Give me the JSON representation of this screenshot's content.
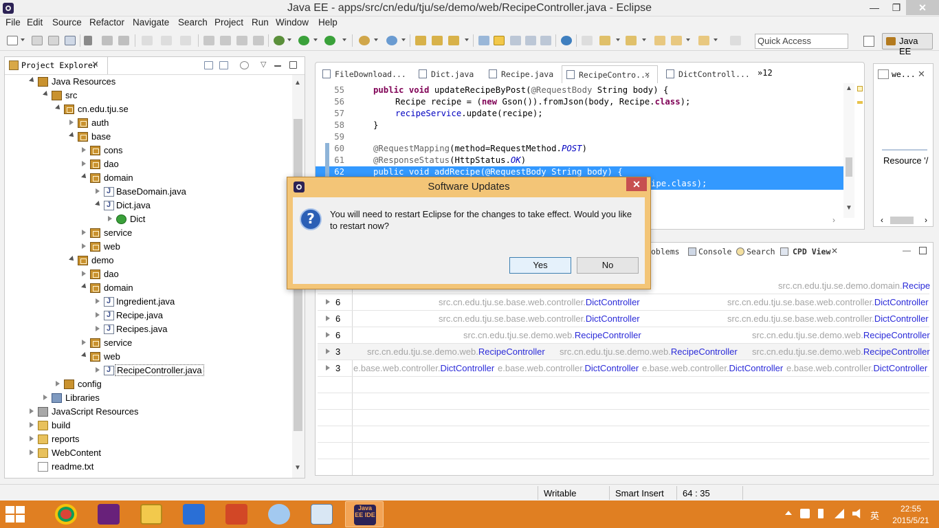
{
  "window": {
    "title": "Java EE - apps/src/cn/edu/tju/se/demo/web/RecipeController.java - Eclipse",
    "minimize": "—",
    "maximize": "❐",
    "close": "✕"
  },
  "menu": [
    "File",
    "Edit",
    "Source",
    "Refactor",
    "Navigate",
    "Search",
    "Project",
    "Run",
    "Window",
    "Help"
  ],
  "toolbar": {
    "quick_access_placeholder": "Quick Access",
    "perspective_label": "Java EE"
  },
  "project_explorer": {
    "tab_label": "Project Explorer",
    "tree": [
      "Java Resources",
      "src",
      "cn.edu.tju.se",
      "auth",
      "base",
      "cons",
      "dao",
      "domain",
      "BaseDomain.java",
      "Dict.java",
      "Dict",
      "service",
      "web",
      "demo",
      "dao",
      "domain",
      "Ingredient.java",
      "Recipe.java",
      "Recipes.java",
      "service",
      "web",
      "RecipeController.java",
      "config",
      "Libraries",
      "JavaScript Resources",
      "build",
      "reports",
      "WebContent",
      "readme.txt"
    ]
  },
  "editor": {
    "tabs": [
      "FileDownload...",
      "Dict.java",
      "Recipe.java",
      "RecipeContro...",
      "DictControll..."
    ],
    "overflow_count": "»12",
    "line_numbers": [
      "55",
      "56",
      "57",
      "58",
      "59",
      "60",
      "61",
      "62"
    ],
    "code": {
      "l55": [
        "public",
        " ",
        "void",
        " updateRecipeByPost(",
        "@RequestBody",
        " String body) {"
      ],
      "l56": [
        "Recipe recipe = (",
        "new",
        " Gson()).fromJson(body, Recipe.",
        "class",
        ");"
      ],
      "l57": [
        "recipeService",
        ".update(recipe);"
      ],
      "l58": "}",
      "l60": [
        "@RequestMapping",
        "(method=RequestMethod.",
        "POST",
        ")"
      ],
      "l61": [
        "@ResponseStatus",
        "(HttpStatus.",
        "OK",
        ")"
      ],
      "l62": "public void addRecipe(@RequestBody String body) {",
      "l63_tail": "ipe.class);"
    }
  },
  "right_view": {
    "tab_label": "we...",
    "content": "Resource '/"
  },
  "bottom_panel": {
    "tabs": [
      "oblems",
      "Console",
      "Search",
      "CPD View"
    ],
    "rows": [
      {
        "count": "",
        "cells": [
          {
            "prefix": "src.cn.edu.tju.se.demo.domain.",
            "cls": "Recipe"
          }
        ]
      },
      {
        "count": "6",
        "cells": [
          {
            "prefix": "src.cn.edu.tju.se.base.web.controller.",
            "cls": "DictController"
          },
          {
            "prefix": "src.cn.edu.tju.se.base.web.controller.",
            "cls": "DictController"
          }
        ]
      },
      {
        "count": "6",
        "cells": [
          {
            "prefix": "src.cn.edu.tju.se.base.web.controller.",
            "cls": "DictController"
          },
          {
            "prefix": "src.cn.edu.tju.se.base.web.controller.",
            "cls": "DictController"
          }
        ]
      },
      {
        "count": "6",
        "cells": [
          {
            "prefix": "src.cn.edu.tju.se.demo.web.",
            "cls": "RecipeController"
          },
          {
            "prefix": "src.cn.edu.tju.se.demo.web.",
            "cls": "RecipeController"
          }
        ]
      },
      {
        "count": "3",
        "cells": [
          {
            "prefix": "src.cn.edu.tju.se.demo.web.",
            "cls": "RecipeController"
          },
          {
            "prefix": "src.cn.edu.tju.se.demo.web.",
            "cls": "RecipeController"
          },
          {
            "prefix": "src.cn.edu.tju.se.demo.web.",
            "cls": "RecipeController"
          }
        ]
      },
      {
        "count": "3",
        "cells": [
          {
            "prefix": "e.base.web.controller.",
            "cls": "DictController"
          },
          {
            "prefix": "e.base.web.controller.",
            "cls": "DictController"
          },
          {
            "prefix": "e.base.web.controller.",
            "cls": "DictController"
          },
          {
            "prefix": "e.base.web.controller.",
            "cls": "DictController"
          }
        ]
      }
    ]
  },
  "status_bar": {
    "mode": "Writable",
    "insert": "Smart Insert",
    "position": "64 : 35"
  },
  "dialog": {
    "title": "Software Updates",
    "message": "You will need to restart Eclipse for the changes to take effect. Would you like to restart now?",
    "yes": "Yes",
    "no": "No",
    "close": "✕",
    "icon": "?"
  },
  "taskbar": {
    "apps": [
      "chrome",
      "visual-studio",
      "file-explorer",
      "messages",
      "powerpoint",
      "paint",
      "performance-monitor",
      "eclipse-java-ee"
    ],
    "eclipse_label": "Java EE IDE",
    "lang": "英",
    "time": "22:55",
    "date": "2015/5/21"
  }
}
